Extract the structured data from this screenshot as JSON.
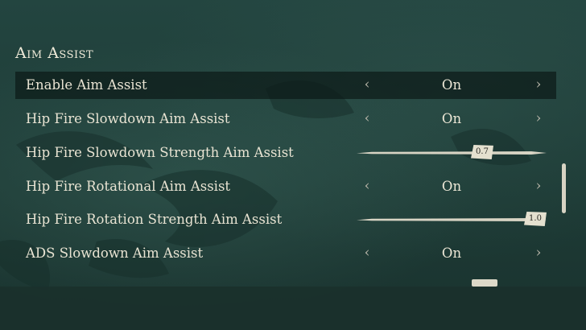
{
  "section": {
    "title": "Aim Assist"
  },
  "rows": [
    {
      "label": "Enable Aim Assist",
      "type": "toggle",
      "value": "On",
      "selected": true
    },
    {
      "label": "Hip Fire Slowdown Aim Assist",
      "type": "toggle",
      "value": "On",
      "selected": false
    },
    {
      "label": "Hip Fire Slowdown Strength Aim Assist",
      "type": "slider",
      "value": "0.7",
      "level": 0.7
    },
    {
      "label": "Hip Fire Rotational Aim Assist",
      "type": "toggle",
      "value": "On",
      "selected": false
    },
    {
      "label": "Hip Fire Rotation Strength Aim Assist",
      "type": "slider",
      "value": "1.0",
      "level": 1.0
    },
    {
      "label": "ADS Slowdown Aim Assist",
      "type": "toggle",
      "value": "On",
      "selected": false
    }
  ],
  "arrows": {
    "left": "‹",
    "right": "›"
  },
  "colors": {
    "background": "#1f3a35",
    "text": "#e6e2d2",
    "highlight": "#0c1a17",
    "slider": "#d8d4c4"
  }
}
